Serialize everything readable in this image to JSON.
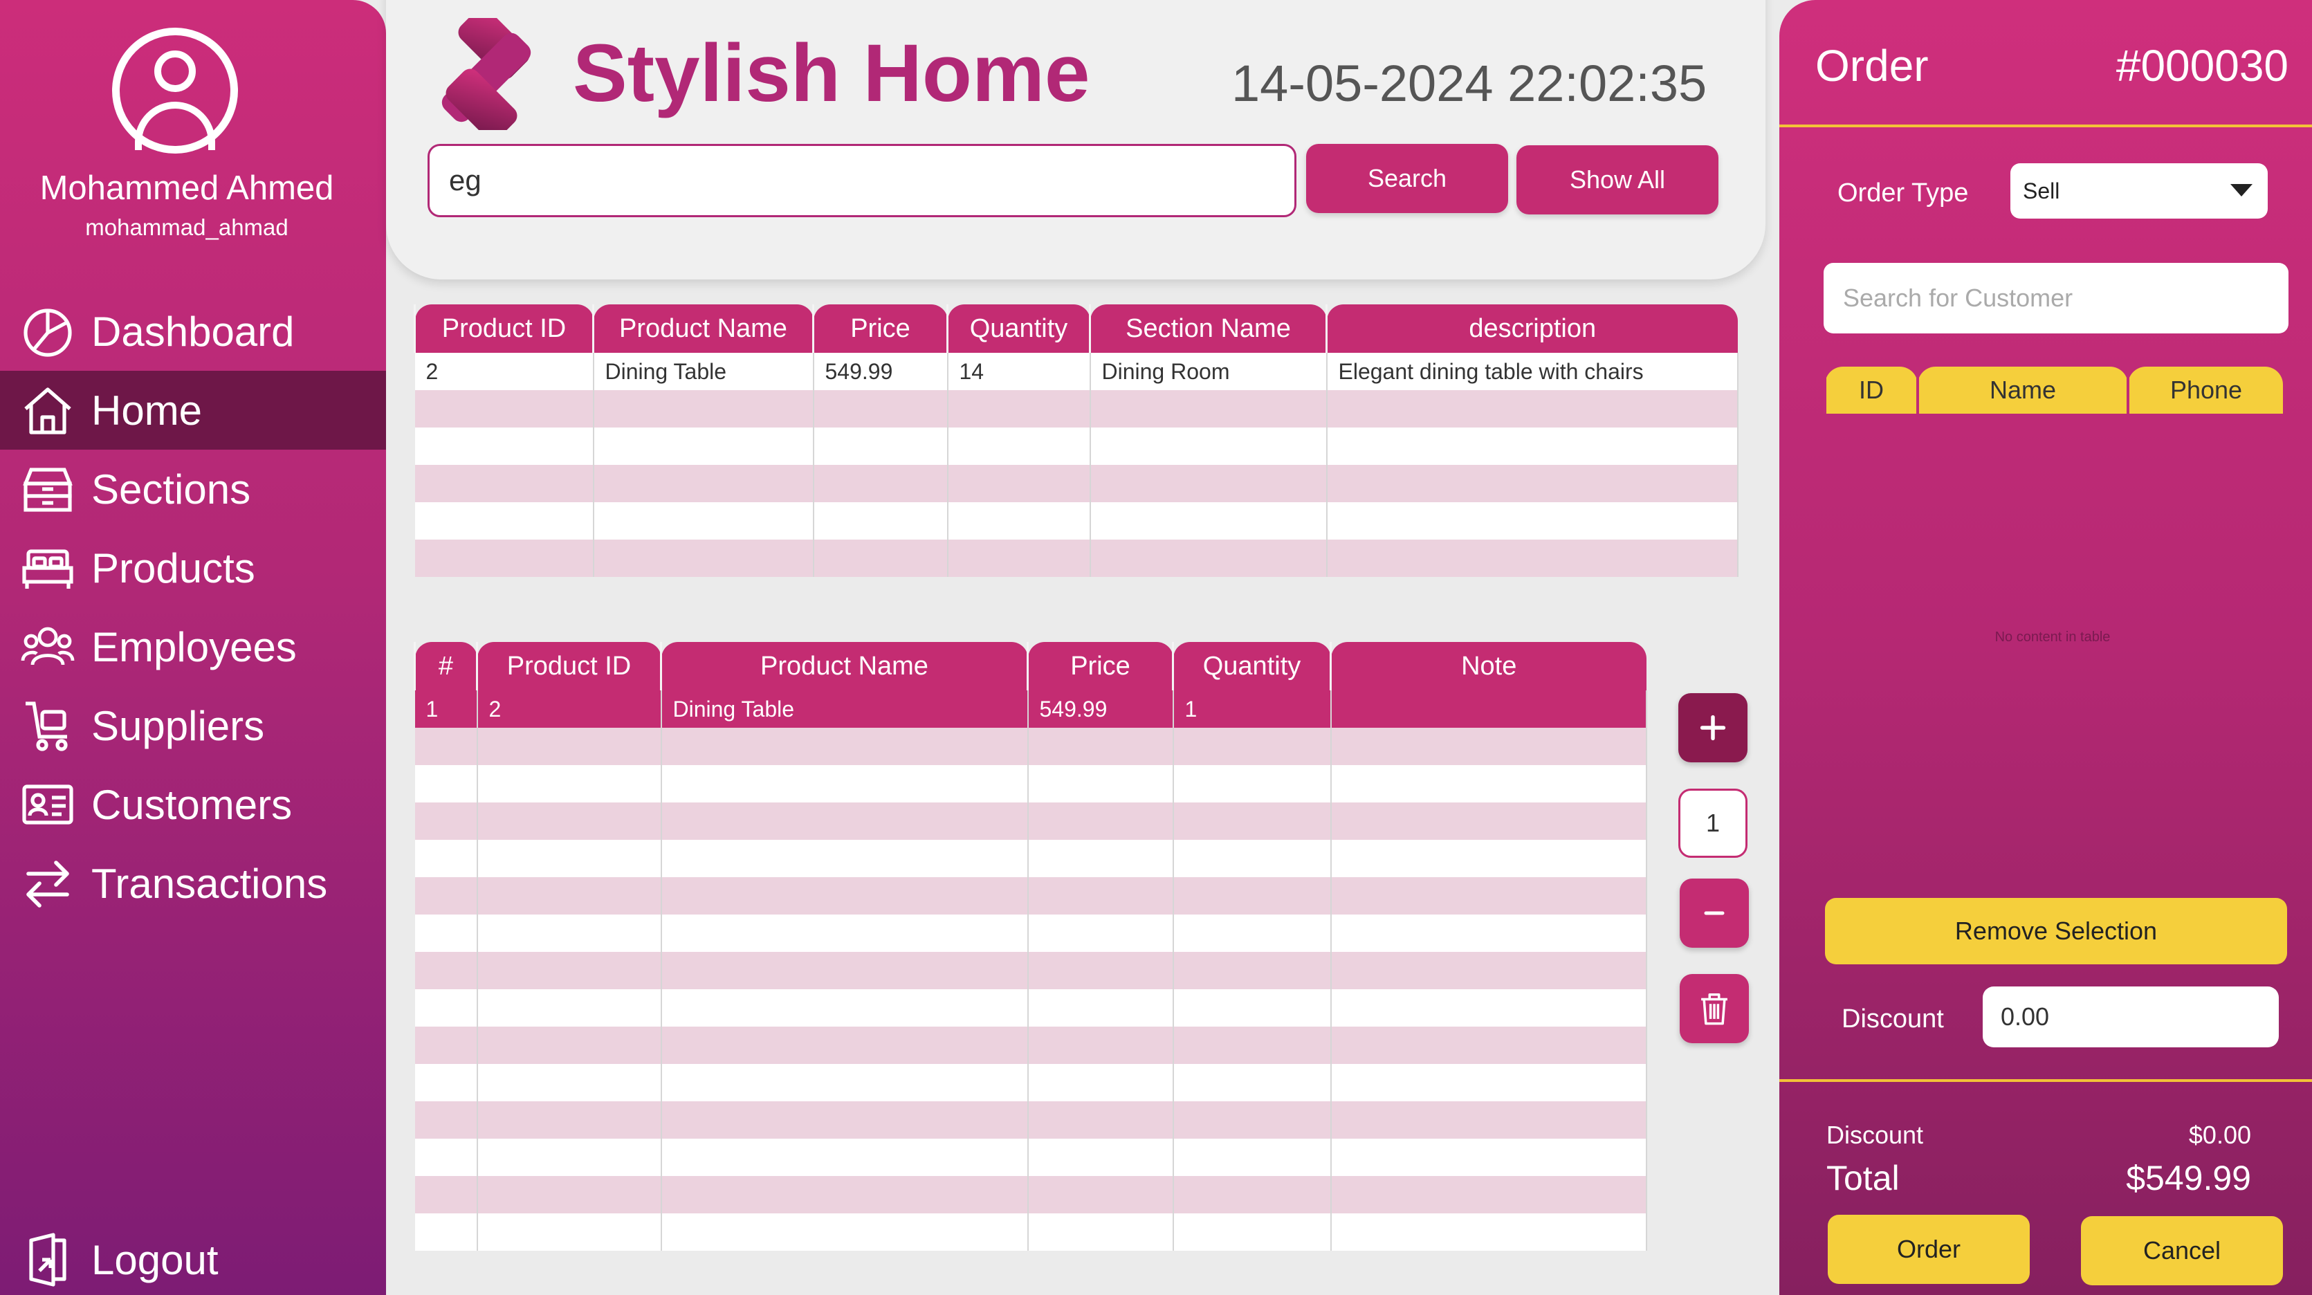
{
  "user": {
    "name": "Mohammed Ahmed",
    "handle": "mohammad_ahmad"
  },
  "nav": {
    "items": [
      {
        "label": "Dashboard",
        "icon": "dashboard-icon"
      },
      {
        "label": "Home",
        "icon": "home-icon",
        "active": true
      },
      {
        "label": "Sections",
        "icon": "sections-icon"
      },
      {
        "label": "Products",
        "icon": "bed-icon"
      },
      {
        "label": "Employees",
        "icon": "employees-icon"
      },
      {
        "label": "Suppliers",
        "icon": "cart-icon"
      },
      {
        "label": "Customers",
        "icon": "id-card-icon"
      },
      {
        "label": "Transactions",
        "icon": "transfer-arrows-icon"
      }
    ],
    "logout": "Logout"
  },
  "header": {
    "brand": "Stylish Home",
    "datetime": "14-05-2024 22:02:35",
    "search_value": "eg",
    "search_button": "Search",
    "show_all_button": "Show All"
  },
  "products_table": {
    "headers": [
      "Product ID",
      "Product Name",
      "Price",
      "Quantity",
      "Section Name",
      "description"
    ],
    "rows": [
      [
        "2",
        "Dining Table",
        "549.99",
        "14",
        "Dining Room",
        "Elegant dining table with chairs"
      ]
    ]
  },
  "cart_table": {
    "headers": [
      "#",
      "Product ID",
      "Product Name",
      "Price",
      "Quantity",
      "Note"
    ],
    "rows": [
      [
        "1",
        "2",
        "Dining Table",
        "549.99",
        "1",
        ""
      ]
    ]
  },
  "cart_controls": {
    "quantity": "1"
  },
  "order": {
    "title": "Order",
    "number": "#000030",
    "type_label": "Order Type",
    "type_value": "Sell",
    "customer_search_placeholder": "Search for Customer",
    "customer_table_headers": [
      "ID",
      "Name",
      "Phone"
    ],
    "no_content": "No content in table",
    "remove_selection": "Remove Selection",
    "discount_label": "Discount",
    "discount_value": "0.00",
    "summary_discount_label": "Discount",
    "summary_discount_value": "$0.00",
    "total_label": "Total",
    "total_value": "$549.99",
    "order_button": "Order",
    "cancel_button": "Cancel"
  },
  "colors": {
    "primary": "#c42c72",
    "accent_yellow": "#f5cf3c",
    "dark_magenta": "#6e1748",
    "row_alt": "#ecd2de"
  }
}
